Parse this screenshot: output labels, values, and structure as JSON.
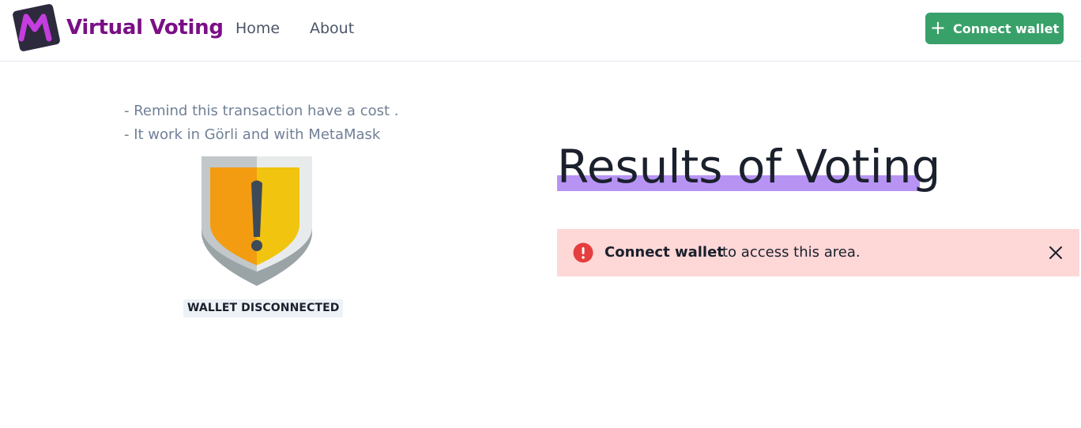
{
  "header": {
    "brand": "Virtual Voting",
    "nav": [
      {
        "label": "Home"
      },
      {
        "label": "About"
      }
    ],
    "connect_button": {
      "label": "Connect wallet",
      "icon": "plus-icon"
    }
  },
  "sidebar": {
    "notes": [
      "- Remind this transaction have a cost .",
      "- It work in Görli and with MetaMask"
    ],
    "shield_icon": "warning-shield-icon",
    "status": "WALLET DISCONNECTED"
  },
  "main": {
    "title": "Results of Voting",
    "alert": {
      "icon": "error-icon",
      "bold": "Connect wallet",
      "text": "to access this area.",
      "close_icon": "close-icon"
    }
  },
  "colors": {
    "brand": "#7a0f86",
    "button": "#38a169",
    "underline": "#b794f4",
    "alert_bg": "#fed7d7",
    "alert_icon": "#e53e3e"
  }
}
